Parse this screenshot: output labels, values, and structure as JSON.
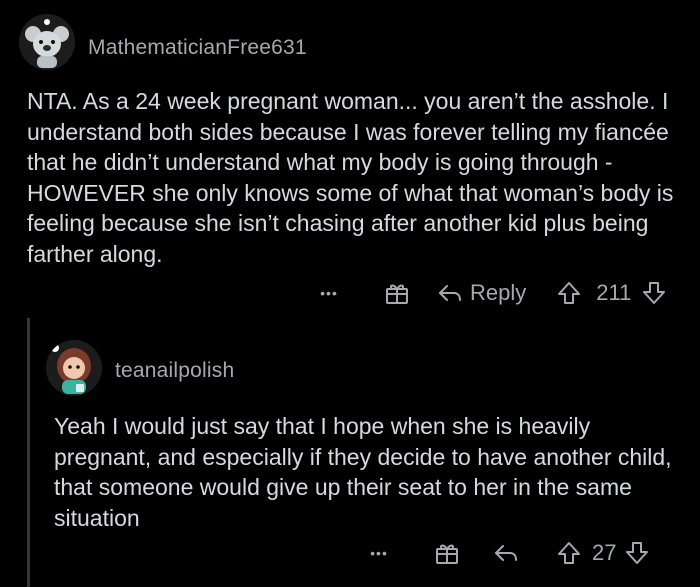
{
  "comments": [
    {
      "username": "MathematicianFree631",
      "body": "NTA. As a 24 week pregnant woman... you aren’t the asshole. I understand both sides because I was forever telling my fiancée that he didn’t understand what my body is going through - HOWEVER she only knows some of what that woman’s body is feeling because she isn’t chasing after another kid plus being farther along.",
      "more": "•••",
      "reply_label": "Reply",
      "votes": "211",
      "icons": {
        "avatar": "koala-avatar-icon",
        "award": "gift-icon",
        "reply": "reply-arrow-icon",
        "upvote": "upvote-arrow-icon",
        "downvote": "downvote-arrow-icon"
      }
    },
    {
      "username": "teanailpolish",
      "body": "Yeah I would just say that I hope when she is heavily pregnant, and especially if they decide to have another child, that someone would give up their seat to her in the same situation",
      "more": "•••",
      "votes": "27",
      "icons": {
        "avatar": "girl-avatar-icon",
        "award": "gift-icon",
        "reply": "reply-arrow-icon",
        "upvote": "upvote-arrow-icon",
        "downvote": "downvote-arrow-icon"
      }
    }
  ]
}
